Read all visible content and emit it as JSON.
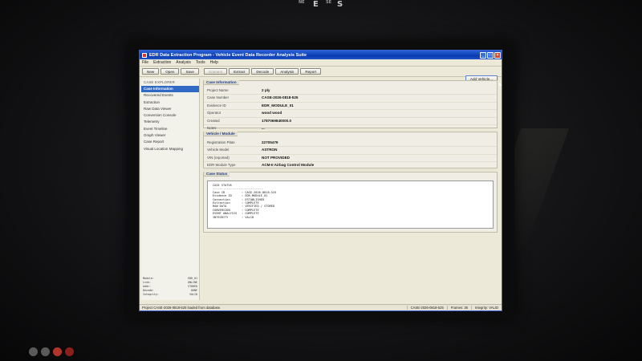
{
  "compass": {
    "ne": "NE",
    "e": "E",
    "se": "SE",
    "s": "S"
  },
  "window": {
    "title": "EDR Data Extraction Program - Vehicle Event Data Recorder Analysis Suite",
    "controls": [
      "_",
      "□",
      "×"
    ]
  },
  "menu": [
    "File",
    "Extraction",
    "Analysis",
    "Tools",
    "Help"
  ],
  "toolbar": {
    "new": "New",
    "open": "Open",
    "save": "Save",
    "connect": "Connect",
    "extract": "Extract",
    "decode": "Decode",
    "analysis": "Analysis",
    "report": "Report",
    "add_vehicle": "Add Vehicle..."
  },
  "sidebar": {
    "header": "CASE EXPLORER",
    "items": [
      {
        "label": "Case Information",
        "active": true
      },
      {
        "label": "Recovered Events"
      },
      {
        "label": "Extraction"
      },
      {
        "label": "Raw Data Viewer"
      },
      {
        "label": "Conversion Console"
      },
      {
        "label": "Telemetry"
      },
      {
        "label": "Event Timeline"
      },
      {
        "label": "Graph Viewer"
      },
      {
        "label": "Case Report"
      },
      {
        "label": "Visual Location Mapping"
      }
    ],
    "stats": [
      {
        "k": "Module:",
        "v": "EDR_01"
      },
      {
        "k": "Link:",
        "v": "ONLINE"
      },
      {
        "k": "Addr:",
        "v": "STORED"
      },
      {
        "k": "Decode:",
        "v": "DONE"
      },
      {
        "k": "Integrity:",
        "v": "VALID"
      }
    ]
  },
  "case_information": {
    "title": "Case Information",
    "fields": [
      {
        "label": "Project Name",
        "value": "2 ply"
      },
      {
        "label": "Case Number",
        "value": "CASE-2026-0818-525"
      },
      {
        "label": "Evidence ID",
        "value": "EDR_MODULE_01"
      },
      {
        "label": "Operator",
        "value": "wood wood"
      },
      {
        "label": "Created",
        "value": "1787069840000.0"
      },
      {
        "label": "Notes",
        "value": "..."
      }
    ]
  },
  "vehicle_module": {
    "title": "Vehicle / Module",
    "fields": [
      {
        "label": "Registration Plate",
        "value": "22705479"
      },
      {
        "label": "Vehicle Model",
        "value": "ASTRON"
      },
      {
        "label": "VIN (reported)",
        "value": "NOT PROVIDED"
      },
      {
        "label": "EDR Module Type",
        "value": "ACM-II Airbag Control Module"
      }
    ]
  },
  "case_status": {
    "title": "Case Status",
    "heading": "CASE STATUS",
    "rule": "-----------------------------",
    "lines": [
      {
        "k": "Case ID",
        "v": ": CASE-2026-0818-525"
      },
      {
        "k": "Evidence ID",
        "v": ": EDR_MODULE_01"
      },
      {
        "k": "Connection",
        "v": ": ESTABLISHED"
      },
      {
        "k": "Extraction",
        "v": ": COMPLETE"
      },
      {
        "k": "RAW DATA",
        "v": ": VERIFIED / STORED"
      },
      {
        "k": "CONVERSION",
        "v": ": COMPLETE"
      },
      {
        "k": "EVENT ANALYSIS",
        "v": ": COMPLETE"
      },
      {
        "k": "INTEGRITY",
        "v": ": VALID"
      }
    ]
  },
  "statusbar": {
    "message": "Project CASE-2026-0818-525 loaded from database.",
    "case": "CASE-2026-0818-525",
    "frames": "Frames: 36",
    "integrity": "Integrity: VALID"
  }
}
